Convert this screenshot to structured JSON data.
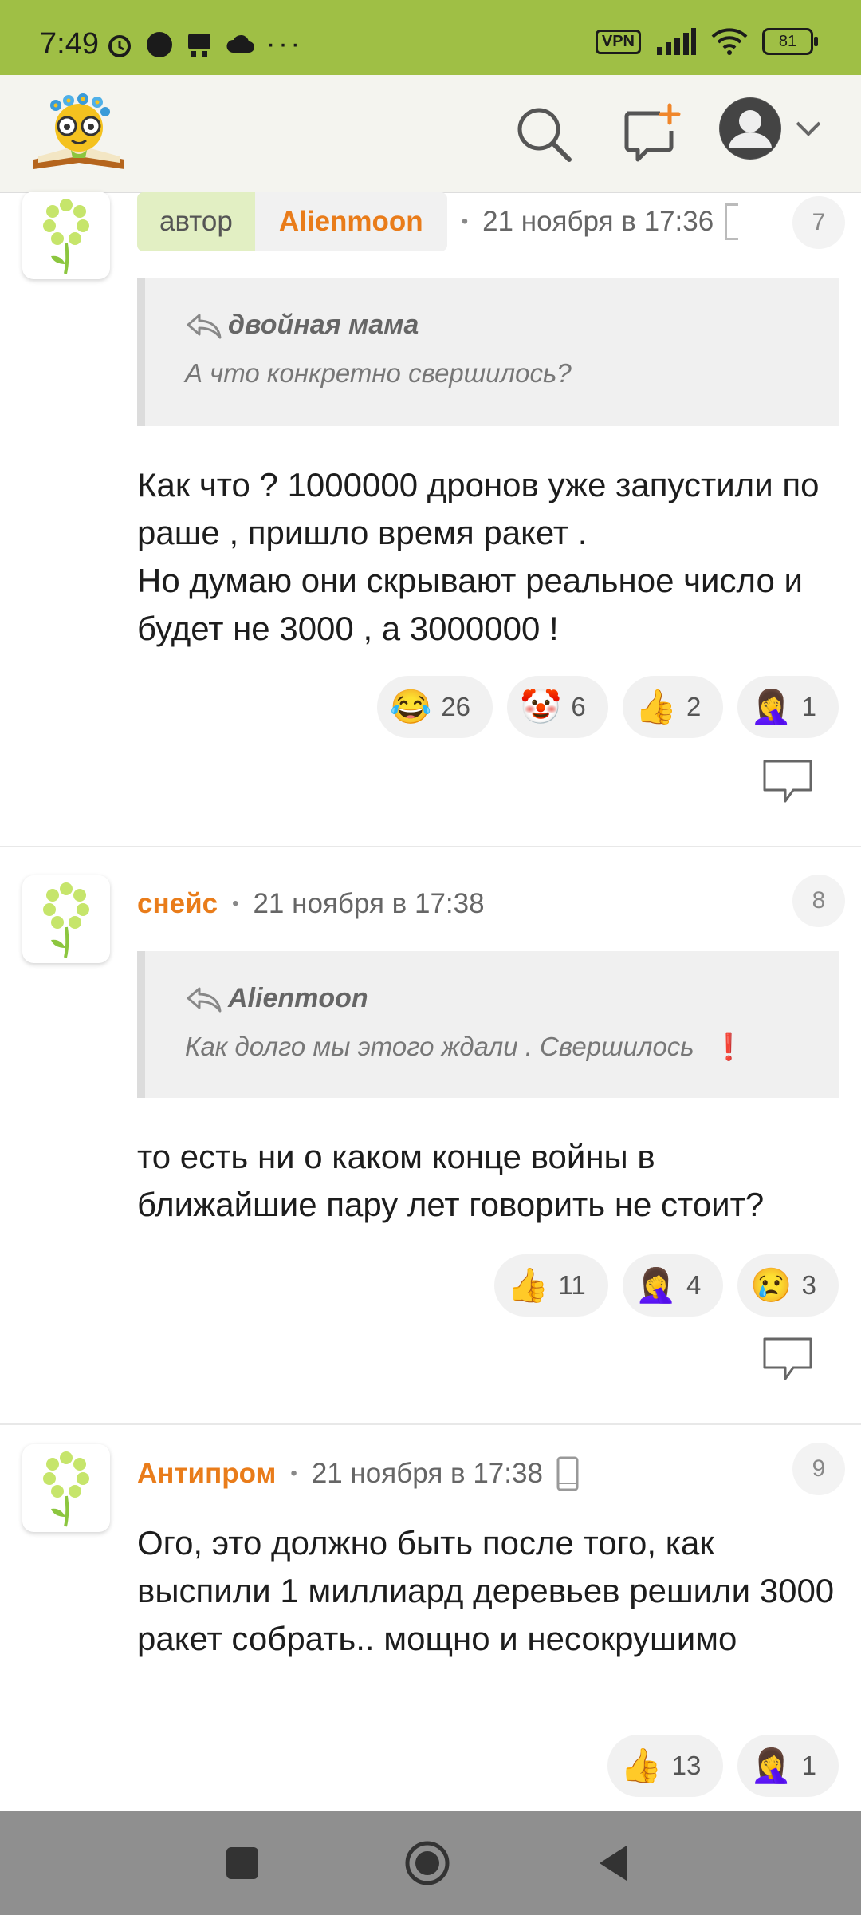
{
  "status": {
    "time": "7:49",
    "vpn": "VPN",
    "battery": "81"
  },
  "comments": [
    {
      "badge": "автор",
      "author": "Alienmoon",
      "date": "21 ноября в 17:36",
      "number": "7",
      "quote_author": "двойная мама",
      "quote_text": "А что конкретно свершилось?",
      "text": "Как что ? 1000000 дронов уже запустили по раше , пришло время ракет .\nНо думаю они скрывают реальное число и будет не 3000 , а 3000000 !",
      "reactions": [
        {
          "emoji": "😂",
          "count": "26"
        },
        {
          "emoji": "🤡",
          "count": "6"
        },
        {
          "emoji": "👍",
          "count": "2"
        },
        {
          "emoji": "🤦‍♀️",
          "count": "1"
        }
      ]
    },
    {
      "author": "снейс",
      "date": "21 ноября в 17:38",
      "number": "8",
      "quote_author": "Alienmoon",
      "quote_text": "Как долго мы этого ждали . Свершилось",
      "quote_emoji": "❗",
      "text": "то есть ни о каком конце войны в ближайшие пару лет говорить не стоит?",
      "reactions": [
        {
          "emoji": "👍",
          "count": "11"
        },
        {
          "emoji": "🤦‍♀️",
          "count": "4"
        },
        {
          "emoji": "😢",
          "count": "3"
        }
      ]
    },
    {
      "author": "Антипром",
      "date": "21 ноября в 17:38",
      "number": "9",
      "text": "Ого, это должно быть после того, как выспили 1 миллиард деревьев решили 3000 ракет собрать.. мощно и несокрушимо",
      "reactions": [
        {
          "emoji": "👍",
          "count": "13"
        },
        {
          "emoji": "🤦‍♀️",
          "count": "1"
        }
      ]
    }
  ]
}
